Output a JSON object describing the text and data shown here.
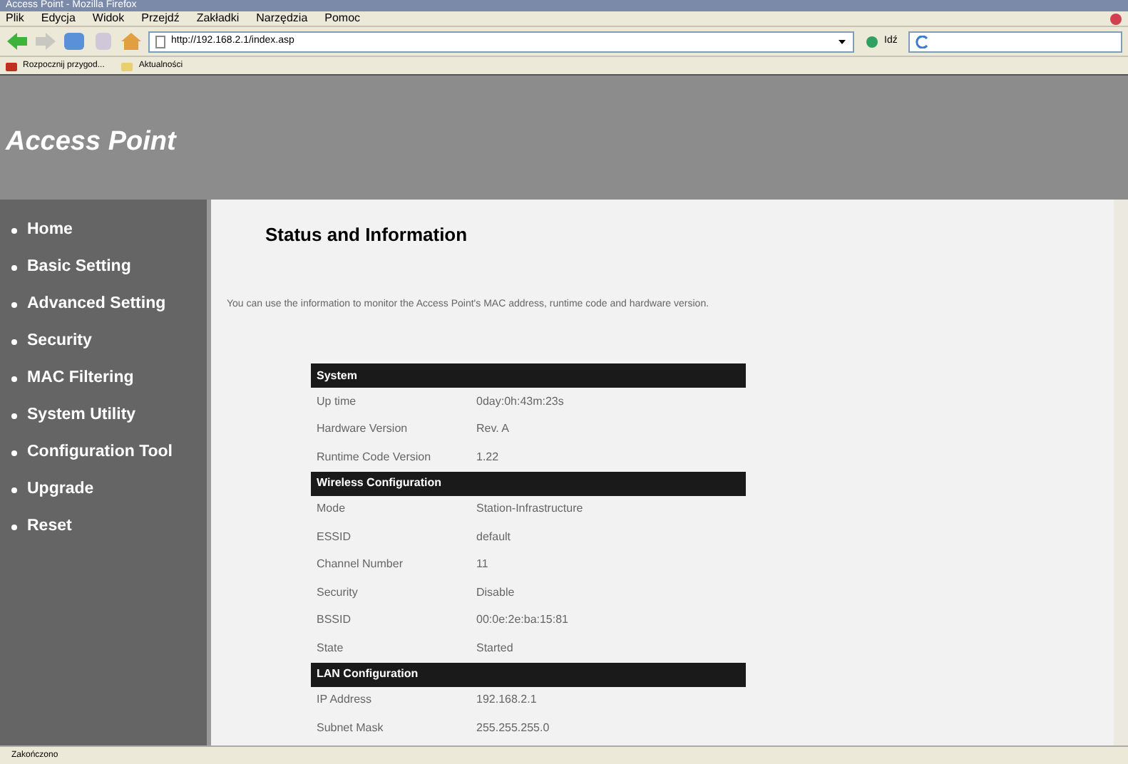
{
  "window": {
    "title": "Access Point - Mozilla Firefox"
  },
  "menu": [
    "Plik",
    "Edycja",
    "Widok",
    "Przejdź",
    "Zakładki",
    "Narzędzia",
    "Pomoc"
  ],
  "address_bar": {
    "value": "http://192.168.2.1/index.asp",
    "go": "Idź"
  },
  "bookmarks": [
    "Rozpocznij przygod...",
    "Aktualności"
  ],
  "header": {
    "title": "Access Point"
  },
  "sidebar": {
    "items": [
      {
        "label": "Home"
      },
      {
        "label": "Basic Setting"
      },
      {
        "label": "Advanced Setting"
      },
      {
        "label": "Security"
      },
      {
        "label": "MAC Filtering"
      },
      {
        "label": "System Utility"
      },
      {
        "label": "Configuration Tool"
      },
      {
        "label": "Upgrade"
      },
      {
        "label": "Reset"
      }
    ]
  },
  "content": {
    "title": "Status and Information",
    "description": "You can use the information to monitor the Access Point's MAC address, runtime code and hardware version.",
    "sections": [
      {
        "title": "System",
        "rows": [
          [
            "Up time",
            "0day:0h:43m:23s"
          ],
          [
            "Hardware Version",
            "Rev. A"
          ],
          [
            "Runtime Code Version",
            "1.22"
          ]
        ]
      },
      {
        "title": "Wireless Configuration",
        "rows": [
          [
            "Mode",
            "Station-Infrastructure"
          ],
          [
            "ESSID",
            "default"
          ],
          [
            "Channel Number",
            "11"
          ],
          [
            "Security",
            "Disable"
          ],
          [
            "BSSID",
            "00:0e:2e:ba:15:81"
          ],
          [
            "State",
            "Started"
          ]
        ]
      },
      {
        "title": "LAN Configuration",
        "rows": [
          [
            "IP Address",
            "192.168.2.1"
          ],
          [
            "Subnet Mask",
            "255.255.255.0"
          ]
        ]
      }
    ]
  },
  "status_bar": "Zakończono"
}
